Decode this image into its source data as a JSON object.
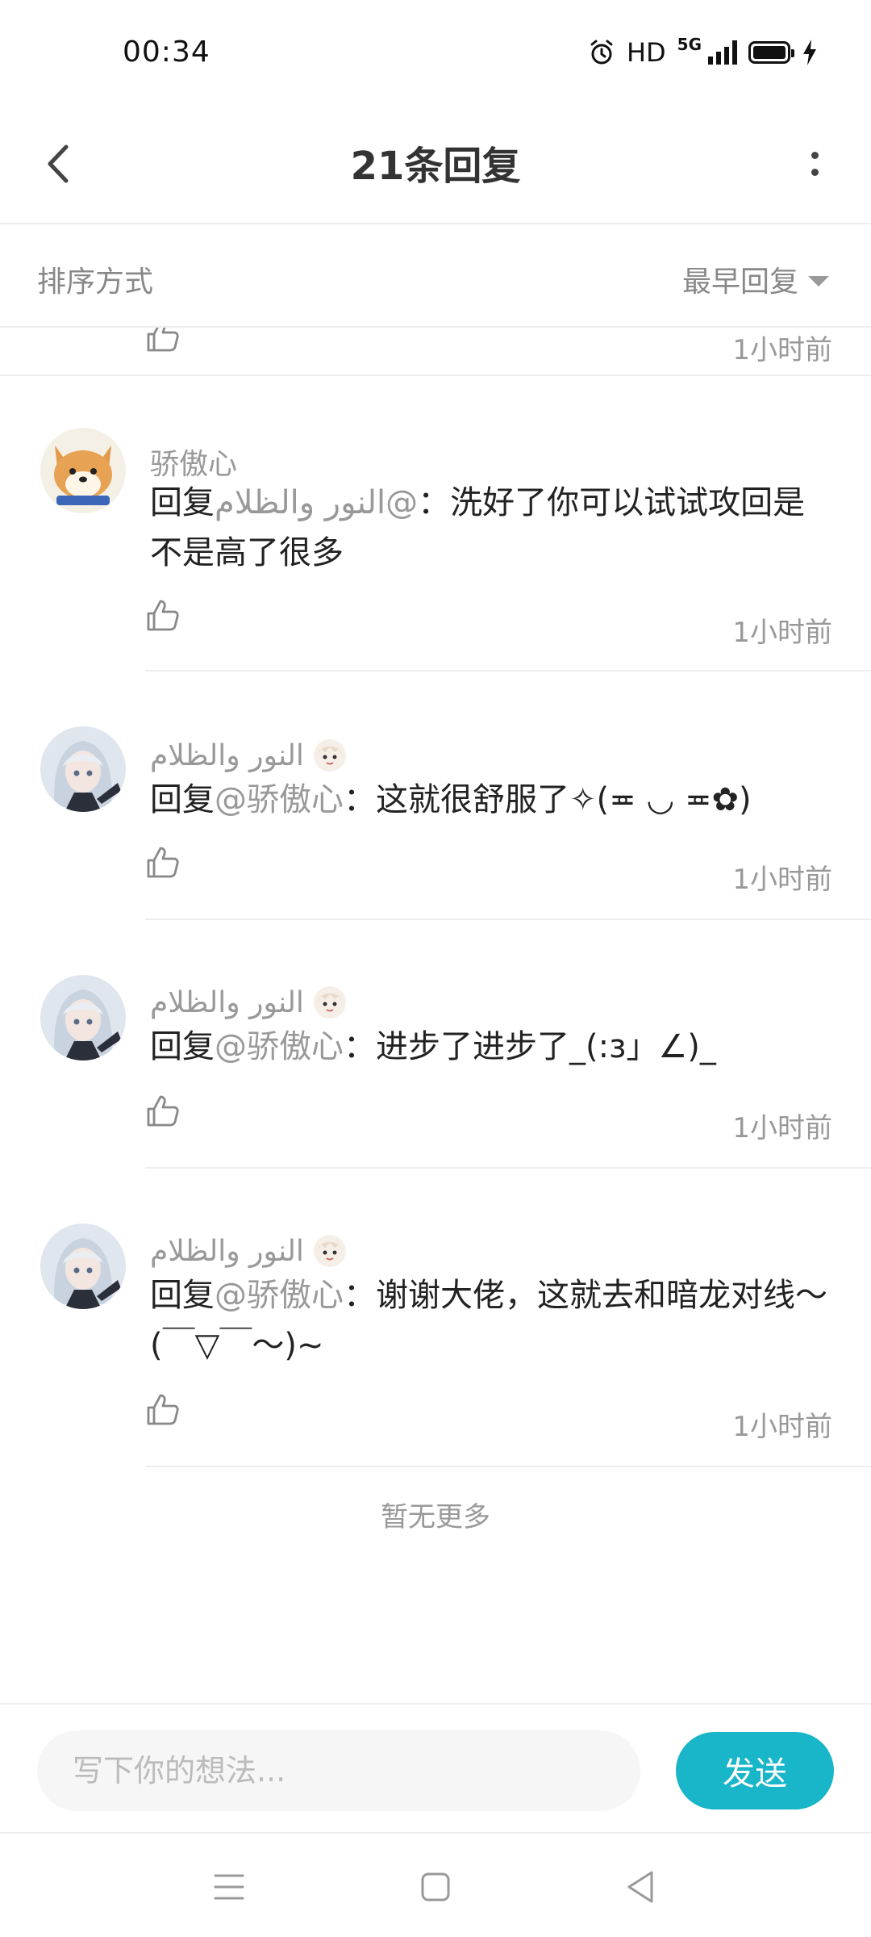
{
  "status_bar": {
    "time": "00:34",
    "hd": "HD",
    "network": "5G",
    "icons": [
      "alarm-icon",
      "signal-icon",
      "battery-icon",
      "charging-icon"
    ]
  },
  "header": {
    "title": "21条回复",
    "back_icon": "chevron-left-icon",
    "more_icon": "more-vertical-icon"
  },
  "sort": {
    "label": "排序方式",
    "value": "最早回复"
  },
  "partial_row": {
    "time": "1小时前"
  },
  "replies": [
    {
      "author": "骄傲心",
      "prefix": "回复",
      "mention": "@النور والظلام",
      "body": "：洗好了你可以试试攻回是不是高了很多",
      "time": "1小时前"
    },
    {
      "author": "النور والظلام",
      "prefix": "回复",
      "mention": "@骄傲心",
      "body": "：这就很舒服了✧(≖ ◡ ≖✿)",
      "time": "1小时前"
    },
    {
      "author": "النور والظلام",
      "prefix": "回复",
      "mention": "@骄傲心",
      "body": "：进步了进步了_(:з」∠)_",
      "time": "1小时前"
    },
    {
      "author": "النور والظلام",
      "prefix": "回复",
      "mention": "@骄傲心",
      "body": "：谢谢大佬，这就去和暗龙对线～(￣▽￣～)~",
      "time": "1小时前"
    }
  ],
  "no_more": "暂无更多",
  "composer": {
    "placeholder": "写下你的想法...",
    "send_label": "发送"
  },
  "colors": {
    "accent": "#19b5c8",
    "muted_text": "#999999",
    "divider": "#eeeeee"
  }
}
